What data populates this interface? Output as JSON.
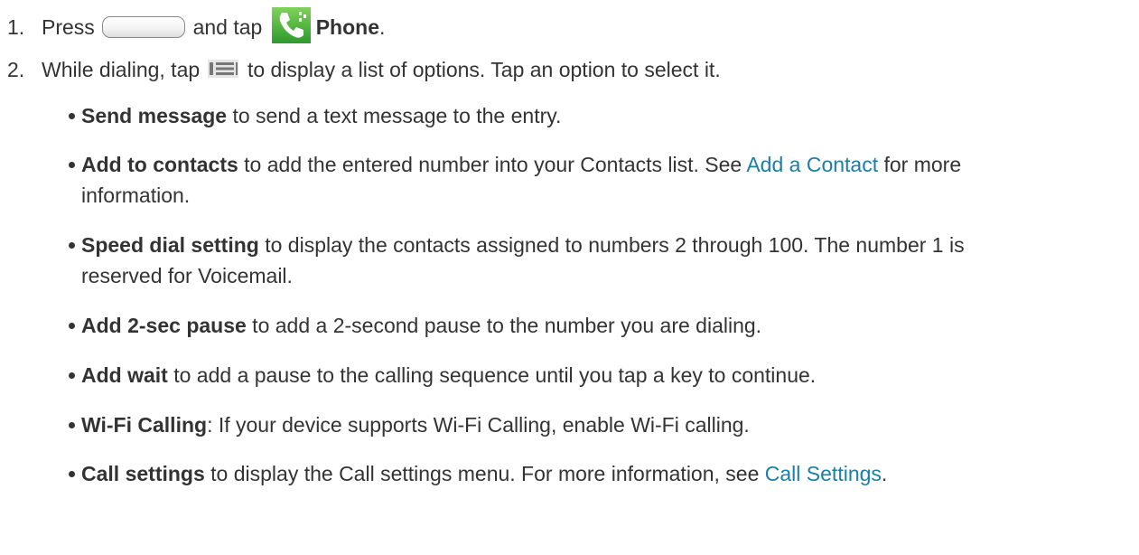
{
  "step1": {
    "number": "1.",
    "text_press": "Press",
    "home_key_icon": "home-key",
    "text_and_tap": "and tap",
    "phone_icon": "phone-app-icon",
    "app_name": "Phone",
    "end": "."
  },
  "step2": {
    "number": "2.",
    "text_before": "While dialing, tap",
    "menu_icon": "menu-key-icon",
    "text_after": "to display a list of options. Tap an option to select it."
  },
  "options": [
    {
      "term": "Send message",
      "rest": " to send a text message to the entry."
    },
    {
      "term": "Add to contacts",
      "rest": " to add the entered number into your Contacts list. See ",
      "link": "Add a Contact",
      "rest2": " for more information."
    },
    {
      "term": "Speed dial setting",
      "rest": " to display the contacts assigned to numbers 2 through 100. The number 1 is reserved for Voicemail."
    },
    {
      "term": "Add 2-sec pause",
      "rest": " to add a 2-second pause to the number you are dialing."
    },
    {
      "term": "Add wait",
      "rest": " to add a pause to the calling sequence until you tap a key to continue."
    },
    {
      "term": "Wi-Fi Calling",
      "rest": ": If your device supports Wi-Fi Calling, enable Wi-Fi calling."
    },
    {
      "term": "Call settings",
      "rest": " to display the Call settings menu. For more information, see ",
      "link": "Call Settings",
      "rest2": "."
    }
  ],
  "colors": {
    "text": "#333333",
    "link": "#1a7fa6",
    "phone_icon_green": "#3aa83a"
  }
}
